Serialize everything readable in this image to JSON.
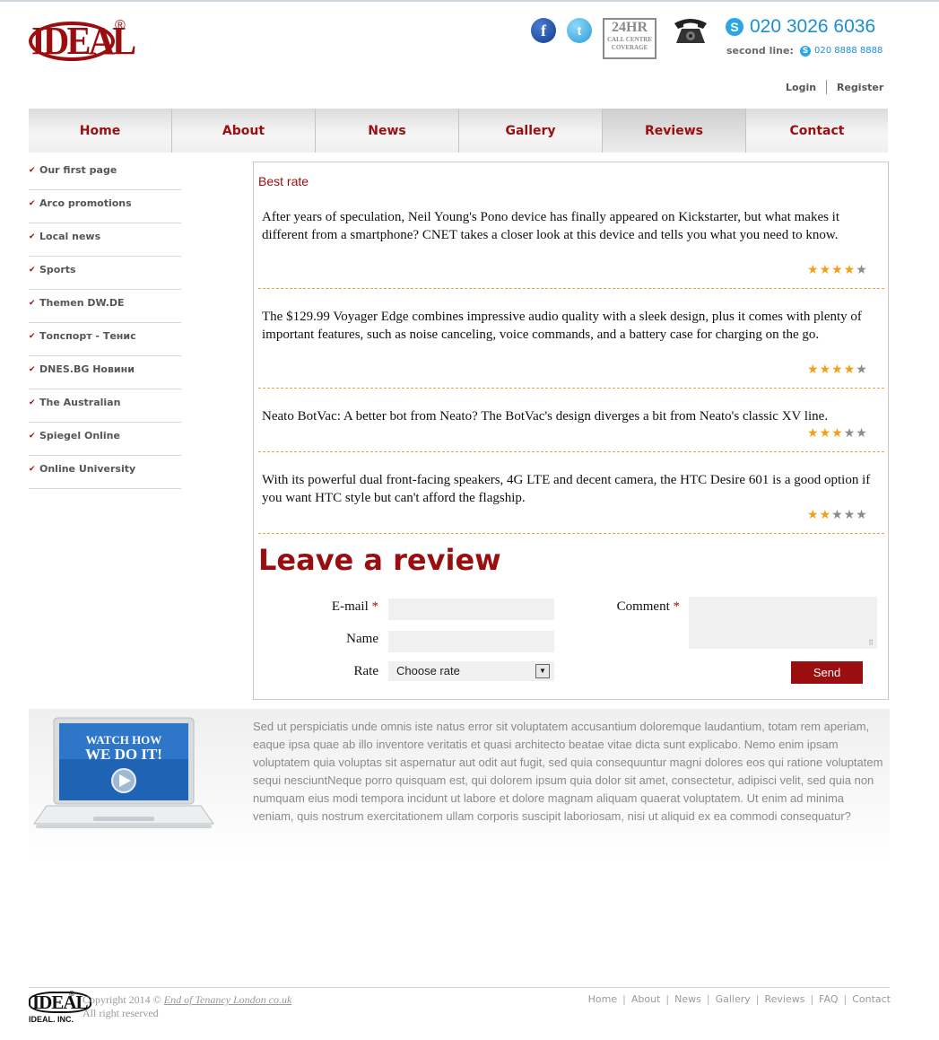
{
  "header": {
    "logo_text": "IDEAL",
    "logo_reg": "®",
    "callcentre_big": "24HR",
    "callcentre_small_1": "CALL CENTRE",
    "callcentre_small_2": "COVERAGE",
    "phone_main": "020 3026 6036",
    "second_line_label": "second line:",
    "phone_second": "020 8888 8888",
    "login": "Login",
    "register": "Register",
    "icons": [
      "facebook-icon",
      "twitter-icon",
      "call-centre-icon",
      "telephone-icon",
      "skype-icon"
    ]
  },
  "nav": {
    "items": [
      "Home",
      "About",
      "News",
      "Gallery",
      "Reviews",
      "Contact"
    ],
    "active": "Reviews"
  },
  "sidebar": {
    "items": [
      "Our first page",
      "Arco promotions",
      "Local news",
      "Sports",
      "Themen DW.DE",
      "Топспорт - Тенис",
      "DNES.BG Новини",
      "The Australian",
      "Spiegel Online",
      "Online University"
    ]
  },
  "main": {
    "section_title": "Best rate",
    "reviews": [
      {
        "text": "After years of speculation, Neil Young's Pono device has finally appeared on Kickstarter, but what makes it different from a smartphone? CNET takes a closer look at this device and tells you what you need to know.",
        "rating": 4,
        "max": 5
      },
      {
        "text": "The $129.99 Voyager Edge combines impressive audio quality with a sleek design, plus it comes with plenty of important features, such as noise canceling, voice commands, and a battery case for charging on the go.",
        "rating": 4,
        "max": 5
      },
      {
        "text": "Neato BotVac: A better bot from Neato? The BotVac's design diverges a bit from Neato's classic XV line.",
        "rating": 3,
        "max": 5
      },
      {
        "text": "With its powerful dual front-facing speakers, 4G LTE and decent camera, the HTC Desire 601 is a good option if you want HTC style but can't afford the flagship.",
        "rating": 2,
        "max": 5
      }
    ]
  },
  "form": {
    "title": "Leave a review",
    "email_label": "E-mail",
    "name_label": "Name",
    "rate_label": "Rate",
    "comment_label": "Comment",
    "required_mark": "*",
    "email_value": "",
    "name_value": "",
    "comment_value": "",
    "rate_selected": "Choose rate",
    "send": "Send"
  },
  "promo": {
    "video_line1": "WATCH HOW",
    "video_line2": "WE DO IT!",
    "text": "Sed ut perspiciatis unde omnis iste natus error sit voluptatem accusantium doloremque laudantium, totam rem aperiam, eaque ipsa quae ab illo inventore veritatis et quasi architecto beatae vitae dicta sunt explicabo. Nemo enim ipsam voluptatem quia voluptas sit aspernatur aut odit aut fugit, sed quia consequuntur magni dolores eos qui ratione voluptatem sequi nesciuntNeque porro quisquam est, qui dolorem ipsum quia dolor sit amet, consectetur, adipisci velit, sed quia non numquam eius modi tempora incidunt ut labore et dolore magnam aliquam quaerat voluptatem. Ut enim ad minima veniam, quis nostrum exercitationem ullam corporis suscipit laboriosam, nisi ut aliquid ex ea commodi consequatur?"
  },
  "footer": {
    "logo_text": "IDEAL",
    "logo_reg": "®",
    "logo_inc": "IDEAL. INC.",
    "copyright_prefix": "Copyright 2014 ©",
    "copyright_link": "End of Tenancy London co.uk",
    "rights": "All right reserved",
    "nav": [
      "Home",
      "About",
      "News",
      "Gallery",
      "Reviews",
      "FAQ",
      "Contact"
    ]
  },
  "colors": {
    "brand": "#9b0e10",
    "accent_blue": "#1a8fd6",
    "star_on": "#f2a015",
    "star_off": "#8c8c8c",
    "divider": "#e6a63a"
  }
}
